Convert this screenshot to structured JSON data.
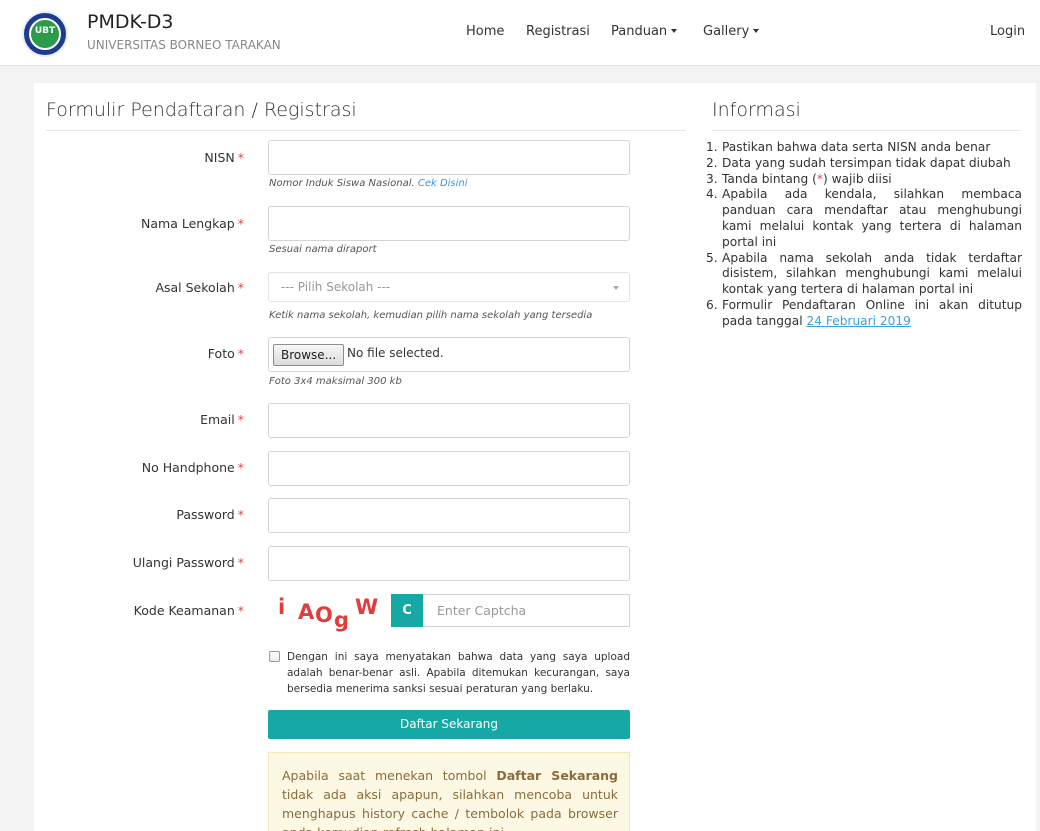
{
  "brand": {
    "title": "PMDK-D3",
    "subtitle": "UNIVERSITAS BORNEO TARAKAN",
    "logo_text": "UBT"
  },
  "nav": {
    "home": "Home",
    "registrasi": "Registrasi",
    "panduan": "Panduan",
    "gallery": "Gallery",
    "login": "Login"
  },
  "form": {
    "title": "Formulir Pendaftaran / Registrasi",
    "required_mark": "*",
    "nisn": {
      "label": "NISN",
      "help": "Nomor Induk Siswa Nasional.",
      "help_link": "Cek Disini",
      "value": ""
    },
    "nama": {
      "label": "Nama Lengkap",
      "help": "Sesuai nama diraport",
      "value": ""
    },
    "sekolah": {
      "label": "Asal Sekolah",
      "selected": "--- Pilih Sekolah ---",
      "help": "Ketik nama sekolah, kemudian pilih nama sekolah yang tersedia"
    },
    "foto": {
      "label": "Foto",
      "button": "Browse...",
      "status": "No file selected.",
      "help": "Foto 3x4 maksimal 300 kb"
    },
    "email": {
      "label": "Email",
      "value": ""
    },
    "handphone": {
      "label": "No Handphone",
      "value": ""
    },
    "password": {
      "label": "Password",
      "value": ""
    },
    "ulangi_password": {
      "label": "Ulangi Password",
      "value": ""
    },
    "captcha": {
      "label": "Kode Keamanan",
      "chars": [
        "i",
        "A",
        "O",
        "g",
        "W"
      ],
      "refresh_icon": "C",
      "placeholder": "Enter Captcha"
    },
    "agreement": "Dengan ini saya menyatakan bahwa data yang saya upload adalah benar-benar asli. Apabila ditemukan kecurangan, saya bersedia menerima sanksi sesuai peraturan yang berlaku.",
    "submit": "Daftar Sekarang",
    "notice": {
      "before": "Apabila saat menekan tombol ",
      "bold": "Daftar Sekarang",
      "after": " tidak ada aksi apapun, silahkan mencoba untuk menghapus history cache / tembolok pada browser anda kemudian refresh halaman ini."
    }
  },
  "info": {
    "title": "Informasi",
    "items": [
      {
        "num": "1.",
        "text": "Pastikan bahwa data serta NISN anda benar"
      },
      {
        "num": "2.",
        "text": "Data yang sudah tersimpan tidak dapat diubah"
      },
      {
        "num": "3.",
        "before": "Tanda bintang (",
        "red": "*",
        "after": ") wajib diisi"
      },
      {
        "num": "4.",
        "text": "Apabila ada kendala, silahkan membaca panduan cara mendaftar atau menghubungi kami melalui kontak yang tertera di halaman portal ini"
      },
      {
        "num": "5.",
        "text": "Apabila nama sekolah anda tidak terdaftar disistem, silahkan menghubungi kami melalui kontak yang tertera di halaman portal ini"
      },
      {
        "num": "6.",
        "before": "Formulir Pendaftaran Online ini akan ditutup pada tanggal ",
        "link": "24 Februari 2019"
      }
    ]
  }
}
